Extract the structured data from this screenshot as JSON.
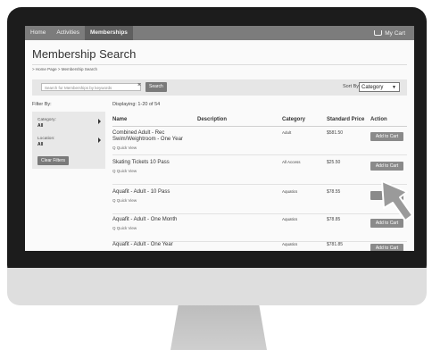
{
  "nav": {
    "items": [
      "Home",
      "Activities",
      "Memberships"
    ],
    "cart": "My Cart"
  },
  "page": {
    "title": "Membership Search",
    "breadcrumb": "> Home Page > Membership Search"
  },
  "search": {
    "placeholder": "Search for Memberships by keywords",
    "clear": "×",
    "button": "Search",
    "sort_label": "Sort By",
    "sort_value": "Category"
  },
  "filters": {
    "heading": "Filter By:",
    "category_label": "Category:",
    "category_value": "All",
    "location_label": "Location:",
    "location_value": "All",
    "clear_button": "Clear Filters"
  },
  "results": {
    "summary": "Displaying: 1-20 of 54",
    "columns": [
      "Name",
      "Description",
      "Category",
      "Standard Price",
      "Action"
    ],
    "quick_view": "Q Quick View",
    "rows": [
      {
        "name": "Combined Adult - Rec Swim/Weightroom - One Year",
        "category": "Adult",
        "price": "$581.50",
        "action": "Add to Cart"
      },
      {
        "name": "Skating Tickets 10 Pass",
        "category": "All Access",
        "price": "$25.50",
        "action": "Add to Cart"
      },
      {
        "name": "Aquafit - Adult - 10 Pass",
        "category": "Aquatics",
        "price": "$78.55",
        "action": "Add"
      },
      {
        "name": "Aquafit - Adult - One Month",
        "category": "Aquatics",
        "price": "$78.85",
        "action": "Add to Cart"
      },
      {
        "name": "Aquafit - Adult - One Year",
        "category": "Aquatics",
        "price": "$781.85",
        "action": "Add to Cart"
      }
    ]
  },
  "colors": {
    "nav_bg": "#7c7c7c",
    "button_bg": "#8a8a8a",
    "bezel": "#1c1c1c"
  }
}
